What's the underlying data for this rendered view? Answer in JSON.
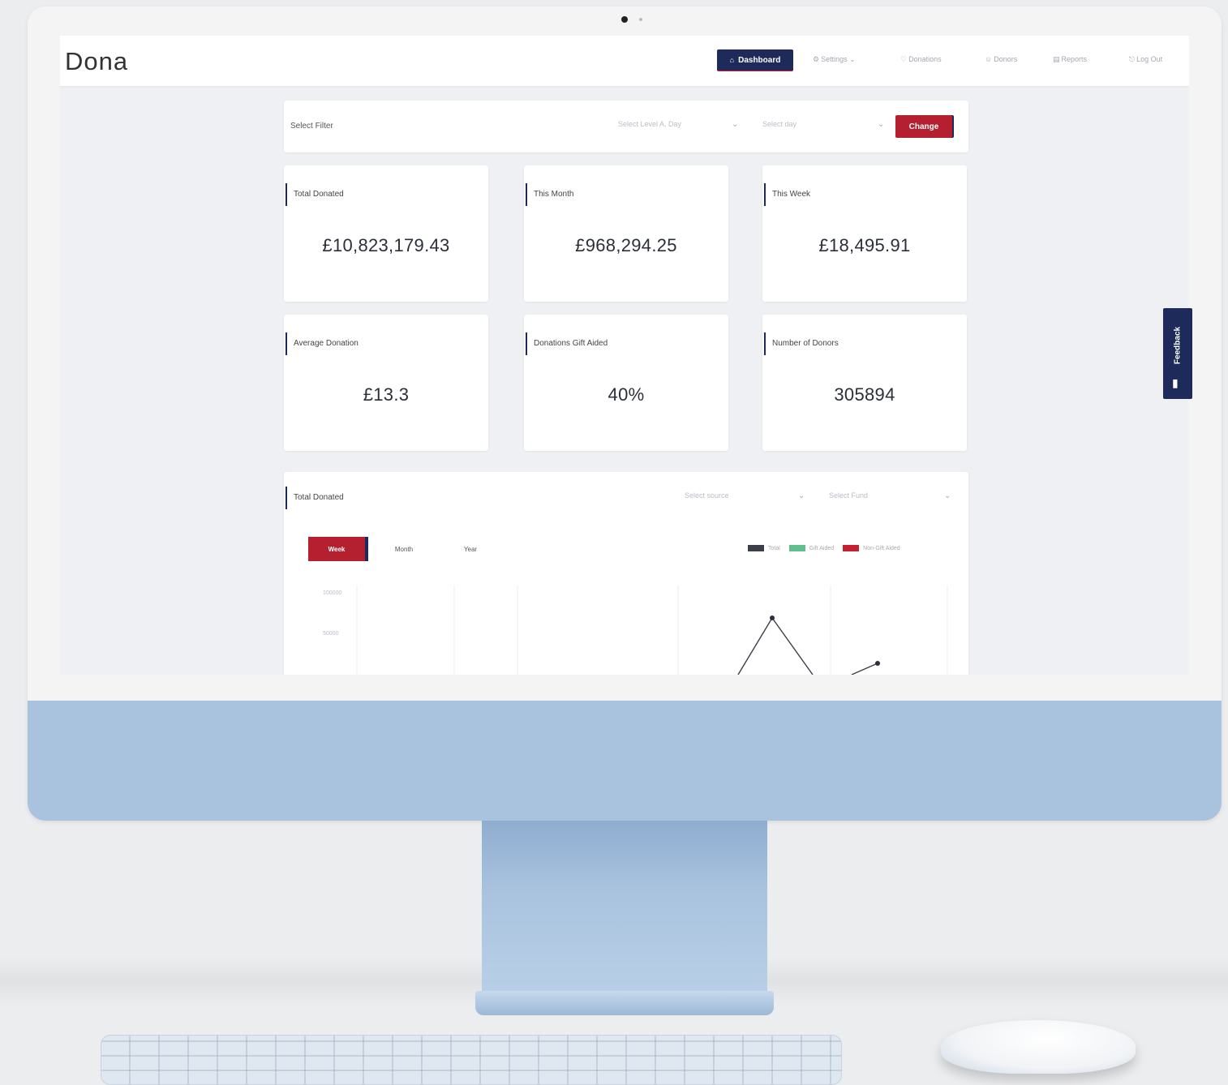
{
  "brand": "Dona",
  "nav": {
    "dashboard": "Dashboard",
    "settings": "Settings",
    "donations": "Donations",
    "donors": "Donors",
    "reports": "Reports",
    "logout": "Log Out"
  },
  "filter": {
    "label": "Select Filter",
    "select_date_placeholder": "Select Level A, Day",
    "select_day_placeholder": "Select day",
    "change_button": "Change"
  },
  "stats": [
    {
      "title": "Total Donated",
      "value": "£10,823,179.43"
    },
    {
      "title": "This Month",
      "value": "£968,294.25"
    },
    {
      "title": "This Week",
      "value": "£18,495.91"
    },
    {
      "title": "Average Donation",
      "value": "£13.3"
    },
    {
      "title": "Donations Gift Aided",
      "value": "40%"
    },
    {
      "title": "Number of Donors",
      "value": "305894"
    }
  ],
  "chart_panel": {
    "title": "Total Donated",
    "select_source_placeholder": "Select source",
    "select_fund_placeholder": "Select Fund",
    "tabs": [
      "Week",
      "Month",
      "Year"
    ],
    "active_tab": "Week",
    "legend": [
      {
        "name": "Total",
        "color": "#3a3f4a"
      },
      {
        "name": "Gift Aided",
        "color": "#5fbf8f"
      },
      {
        "name": "Non-Gift Aided",
        "color": "#c4202f"
      }
    ],
    "y_ticks": [
      "100000",
      "50000"
    ]
  },
  "feedback": {
    "label": "Feedback"
  },
  "colors": {
    "navy": "#1e2a5a",
    "crimson": "#b4202f",
    "chin": "#a9c3df"
  },
  "icons": {
    "dashboard": "home-icon",
    "settings": "gear-icon",
    "donations": "gift-icon",
    "donors": "user-icon",
    "reports": "chart-icon",
    "logout": "logout-icon",
    "feedback": "megaphone-icon"
  }
}
